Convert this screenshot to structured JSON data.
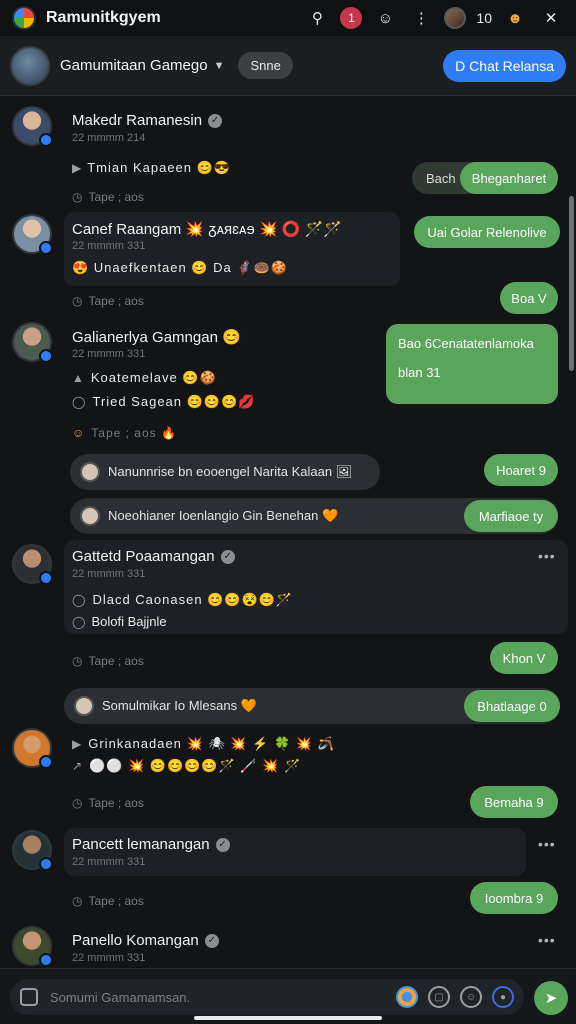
{
  "app": {
    "title": "Ramunitkgyem"
  },
  "topbar": {
    "notif_badge": "1",
    "counter": "10",
    "search_icon": "search-icon",
    "close_icon": "close-icon"
  },
  "header": {
    "group_name": "Gamumitaan Gamego",
    "status_pill": "Snne",
    "action_button": "D Chat Relansa"
  },
  "messages": [
    {
      "name": "Makedr Ramanesin",
      "time": "22 mmmm 214",
      "lines": [
        "Tmian Kapaeen 😊😎"
      ],
      "meta": "Tape ; aos",
      "replies": [
        {
          "label": "Bach",
          "style": "dark"
        },
        {
          "label": "Bheganharet",
          "style": "green"
        }
      ]
    },
    {
      "name": "Canef Raangam 💥 ᵹᴀᴙɛᴀɘ 💥 ⭕ 🪄🪄",
      "time": "22 mmmm 331",
      "lines": [
        "😍 Unaefkentaen 😊 Da 🦸🍩🍪"
      ],
      "meta": "Tape ; aos",
      "replies": [
        {
          "label": "Uai Golar Relenolive",
          "style": "green"
        },
        {
          "label": "Boa V",
          "style": "green"
        }
      ]
    },
    {
      "name": "Galianerlya Gamngan 😊",
      "time": "22 mmmm 331",
      "lines": [
        "Koatemelave 😊🍪",
        "Tried Sagean 😊😊😊💋"
      ],
      "meta": "Tape ; aos 🔥",
      "bubble": [
        "Bao 6Cenatatenlamoka",
        "blan 31"
      ]
    },
    {
      "name": "Gattetd Poaamangan",
      "time": "22 mmmm 331",
      "lines": [
        "Dlacd Caonasen 😊😊😵😊🪄",
        "Bolofi Bajjnle"
      ],
      "meta": "Tape ; aos",
      "replies": [
        {
          "label": "Khon V",
          "style": "green"
        }
      ]
    },
    {
      "name": "Grinkanadaen 💥 🕷 💥 ⚡ 🍀 💥 🪃",
      "time": "",
      "lines": [
        "⚪⚪ 💥 😊😊😊😊🪄 🦯 💥 🪄"
      ],
      "meta": "Tape ; aos",
      "replies": [
        {
          "label": "Bemaha 9",
          "style": "green"
        }
      ]
    },
    {
      "name": "Pancett lemanangan",
      "time": "22 mmmm 331",
      "lines": [],
      "meta": "Tape ; aos",
      "replies": [
        {
          "label": "Ioombra 9",
          "style": "green"
        }
      ]
    },
    {
      "name": "Panello Komangan",
      "time": "22 mmmm 331",
      "lines": [],
      "meta": ""
    }
  ],
  "system_notices": [
    {
      "text": "Nanunnrise bn eooengel Narita Kalaan 🖼",
      "button": "Hoaret 9"
    },
    {
      "text": "Noeohianer Ioenlangio Gin Benehan 🧡",
      "button": "Marfiaoe ty"
    },
    {
      "text": "Somulmikar Io Mlesans 🧡",
      "button": "Bhatlaage 0"
    }
  ],
  "composer": {
    "placeholder": "Somumi Gamamamsan.",
    "send_icon": "send-icon"
  }
}
